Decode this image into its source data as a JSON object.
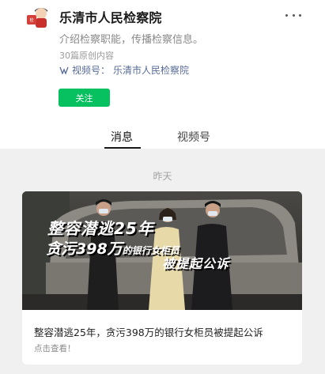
{
  "account": {
    "name": "乐清市人民检察院",
    "avatar_icon": "procuratorate-mascot-avatar",
    "description": "介绍检察职能，传播检察信息。",
    "article_count": "30篇原创内容",
    "channel_prefix": "视频号：",
    "channel_name": "乐清市人民检察院",
    "follow_label": "关注",
    "more_icon": "more-horizontal-icon"
  },
  "tabs": [
    {
      "label": "消息",
      "active": true
    },
    {
      "label": "视频号",
      "active": false
    }
  ],
  "feed": {
    "date_label": "昨天",
    "articles": [
      {
        "cover_line_1": "整容潜逃25年",
        "cover_line_2_a": "贪污398万",
        "cover_line_2_b": "的银行女柜员",
        "cover_line_3": "被提起公诉",
        "title": "整容潜逃25年，贪污398万的银行女柜员被提起公诉",
        "subtitle": "点击查看！"
      }
    ]
  },
  "colors": {
    "accent": "#07c160",
    "link": "#576b95",
    "page_bg": "#f0f0f0"
  }
}
